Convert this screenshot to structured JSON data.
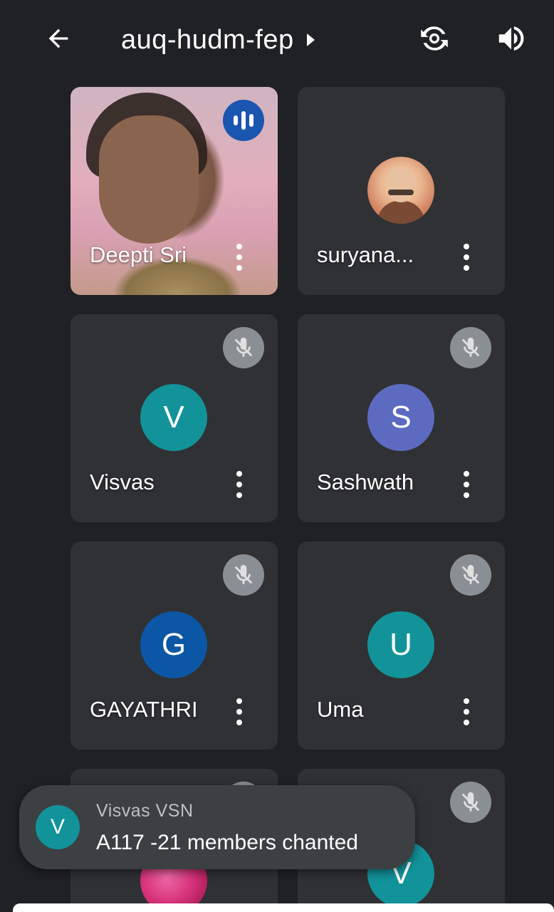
{
  "header": {
    "meeting_code": "auq-hudm-fep",
    "back_icon": "arrow-left-icon",
    "switch_camera_icon": "switch-camera-icon",
    "speaker_icon": "volume-icon"
  },
  "participants": [
    {
      "name": "Deepti Sri",
      "type": "video",
      "speaking": true,
      "muted": false
    },
    {
      "name": "suryana...",
      "type": "photo",
      "muted": false
    },
    {
      "name": "Visvas",
      "initial": "V",
      "avatar_color": "#12939a",
      "muted": true
    },
    {
      "name": "Sashwath",
      "initial": "S",
      "avatar_color": "#5c6bc0",
      "muted": true
    },
    {
      "name": "GAYATHRI",
      "initial": "G",
      "avatar_color": "#0b57a6",
      "muted": true
    },
    {
      "name": "Uma",
      "initial": "U",
      "avatar_color": "#12939a",
      "muted": true
    },
    {
      "name": "",
      "type": "photo",
      "muted": true
    },
    {
      "name": "",
      "initial": "V",
      "avatar_color": "#12939a",
      "muted": true
    }
  ],
  "toast": {
    "sender_initial": "V",
    "sender_name": "Visvas VSN",
    "message": "A117 -21 members chanted"
  },
  "colors": {
    "background": "#202124",
    "tile": "#3c4043",
    "speaking_badge": "#1a56b0"
  }
}
